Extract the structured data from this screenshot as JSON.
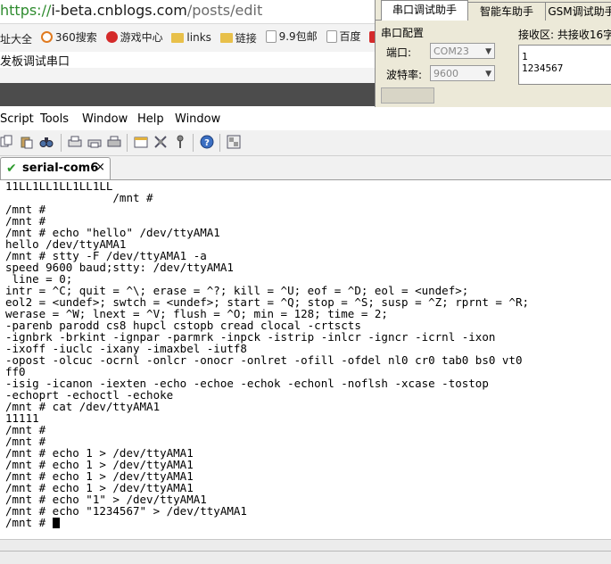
{
  "browser": {
    "url_https": "https://",
    "url_domain": "i-beta.cnblogs.com",
    "url_path": "/posts/edit",
    "bookmarks": [
      {
        "label": "址大全",
        "icon": "none"
      },
      {
        "label": "360搜索",
        "icon": "360-icon"
      },
      {
        "label": "游戏中心",
        "icon": "game-icon"
      },
      {
        "label": "links",
        "icon": "folder-icon"
      },
      {
        "label": "链接",
        "icon": "folder-icon"
      },
      {
        "label": "9.9包邮",
        "icon": "page-icon"
      },
      {
        "label": "百度",
        "icon": "page-icon"
      },
      {
        "label": "京",
        "icon": "jd-icon"
      }
    ],
    "page_title": "发板调试串口"
  },
  "serial_assistant": {
    "tabs": [
      "串口调试助手",
      "智能车助手",
      "GSM调试助手"
    ],
    "group_label": "串口配置",
    "port_label": "端口:",
    "port_value": "COM23",
    "baud_label": "波特率:",
    "baud_value": "9600",
    "receive_label": "接收区: 共接收16字",
    "receive_lines": [
      "1",
      "1234567"
    ]
  },
  "terminal_app": {
    "menu": [
      "Script",
      "Tools",
      "Window",
      "Help",
      "Window"
    ],
    "session_tab": "serial-com6",
    "session_close": "×",
    "lines": [
      "11LL1LL1LL1LL1LL",
      "                /mnt #",
      "/mnt #",
      "/mnt #",
      "/mnt # echo \"hello\" /dev/ttyAMA1",
      "hello /dev/ttyAMA1",
      "/mnt # stty -F /dev/ttyAMA1 -a",
      "speed 9600 baud;stty: /dev/ttyAMA1",
      " line = 0;",
      "intr = ^C; quit = ^\\; erase = ^?; kill = ^U; eof = ^D; eol = <undef>;",
      "eol2 = <undef>; swtch = <undef>; start = ^Q; stop = ^S; susp = ^Z; rprnt = ^R;",
      "werase = ^W; lnext = ^V; flush = ^O; min = 128; time = 2;",
      "-parenb parodd cs8 hupcl cstopb cread clocal -crtscts",
      "-ignbrk -brkint -ignpar -parmrk -inpck -istrip -inlcr -igncr -icrnl -ixon",
      "-ixoff -iuclc -ixany -imaxbel -iutf8",
      "-opost -olcuc -ocrnl -onlcr -onocr -onlret -ofill -ofdel nl0 cr0 tab0 bs0 vt0",
      "ff0",
      "-isig -icanon -iexten -echo -echoe -echok -echonl -noflsh -xcase -tostop",
      "-echoprt -echoctl -echoke",
      "/mnt # cat /dev/ttyAMA1",
      "11111",
      "/mnt #",
      "/mnt #",
      "/mnt # echo 1 > /dev/ttyAMA1",
      "/mnt # echo 1 > /dev/ttyAMA1",
      "/mnt # echo 1 > /dev/ttyAMA1",
      "/mnt # echo 1 > /dev/ttyAMA1",
      "/mnt # echo \"1\" > /dev/ttyAMA1",
      "/mnt # echo \"1234567\" > /dev/ttyAMA1"
    ],
    "prompt": "/mnt # "
  },
  "colors": {
    "check_green": "#2e9b2e",
    "https_green": "#2e8b2e",
    "panel_bg": "#ece9d8"
  }
}
